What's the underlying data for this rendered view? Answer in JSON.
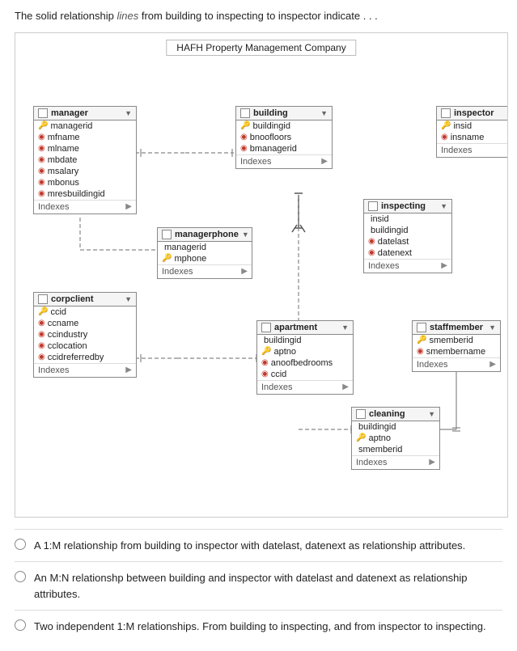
{
  "intro": {
    "text": "The solid relationship lines from building to inspecting to inspector indicate . . ."
  },
  "diagram": {
    "title": "HAFH Property Management Company",
    "tables": {
      "manager": {
        "name": "manager",
        "fields": [
          {
            "type": "pk",
            "name": "managerid"
          },
          {
            "type": "fk",
            "name": "mfname"
          },
          {
            "type": "fk",
            "name": "mlname"
          },
          {
            "type": "fk",
            "name": "mbdate"
          },
          {
            "type": "fk",
            "name": "msalary"
          },
          {
            "type": "fk",
            "name": "mbonus"
          },
          {
            "type": "fk",
            "name": "mresbuildingid"
          }
        ]
      },
      "building": {
        "name": "building",
        "fields": [
          {
            "type": "pk",
            "name": "buildingid"
          },
          {
            "type": "fk",
            "name": "bnoofloors"
          },
          {
            "type": "fk",
            "name": "bmanagerid"
          }
        ]
      },
      "inspector": {
        "name": "inspector",
        "fields": [
          {
            "type": "pk",
            "name": "insid"
          },
          {
            "type": "fk",
            "name": "insname"
          }
        ]
      },
      "inspecting": {
        "name": "inspecting",
        "fields": [
          {
            "type": "plain",
            "name": "insid"
          },
          {
            "type": "plain",
            "name": "buildingid"
          },
          {
            "type": "fk",
            "name": "datelast"
          },
          {
            "type": "fk",
            "name": "datenext"
          }
        ]
      },
      "managerphone": {
        "name": "managerphone",
        "fields": [
          {
            "type": "plain",
            "name": "managerid"
          },
          {
            "type": "pk",
            "name": "mphone"
          }
        ]
      },
      "corpclient": {
        "name": "corpclient",
        "fields": [
          {
            "type": "pk",
            "name": "ccid"
          },
          {
            "type": "fk",
            "name": "ccname"
          },
          {
            "type": "fk",
            "name": "ccindustry"
          },
          {
            "type": "fk",
            "name": "cclocation"
          },
          {
            "type": "fk",
            "name": "ccidreferredby"
          }
        ]
      },
      "apartment": {
        "name": "apartment",
        "fields": [
          {
            "type": "plain",
            "name": "buildingid"
          },
          {
            "type": "pk",
            "name": "aptno"
          },
          {
            "type": "fk",
            "name": "anoofbedrooms"
          },
          {
            "type": "fk",
            "name": "ccid"
          }
        ]
      },
      "staffmember": {
        "name": "staffmember",
        "fields": [
          {
            "type": "pk",
            "name": "smemberid"
          },
          {
            "type": "fk",
            "name": "smembername"
          }
        ]
      },
      "cleaning": {
        "name": "cleaning",
        "fields": [
          {
            "type": "plain",
            "name": "buildingid"
          },
          {
            "type": "pk",
            "name": "aptno"
          },
          {
            "type": "plain",
            "name": "smemberid"
          }
        ]
      }
    },
    "indexes_label": "Indexes"
  },
  "options": [
    {
      "id": "option-a",
      "label": "A 1:M relationship from building to inspector with datelast, datenext as relationship attributes."
    },
    {
      "id": "option-b",
      "label": "An M:N relationshp between building and inspector with datelast and datenext as relationship attributes."
    },
    {
      "id": "option-c",
      "label": "Two independent 1:M relationships. From building to inspecting, and from inspector to inspecting."
    }
  ]
}
